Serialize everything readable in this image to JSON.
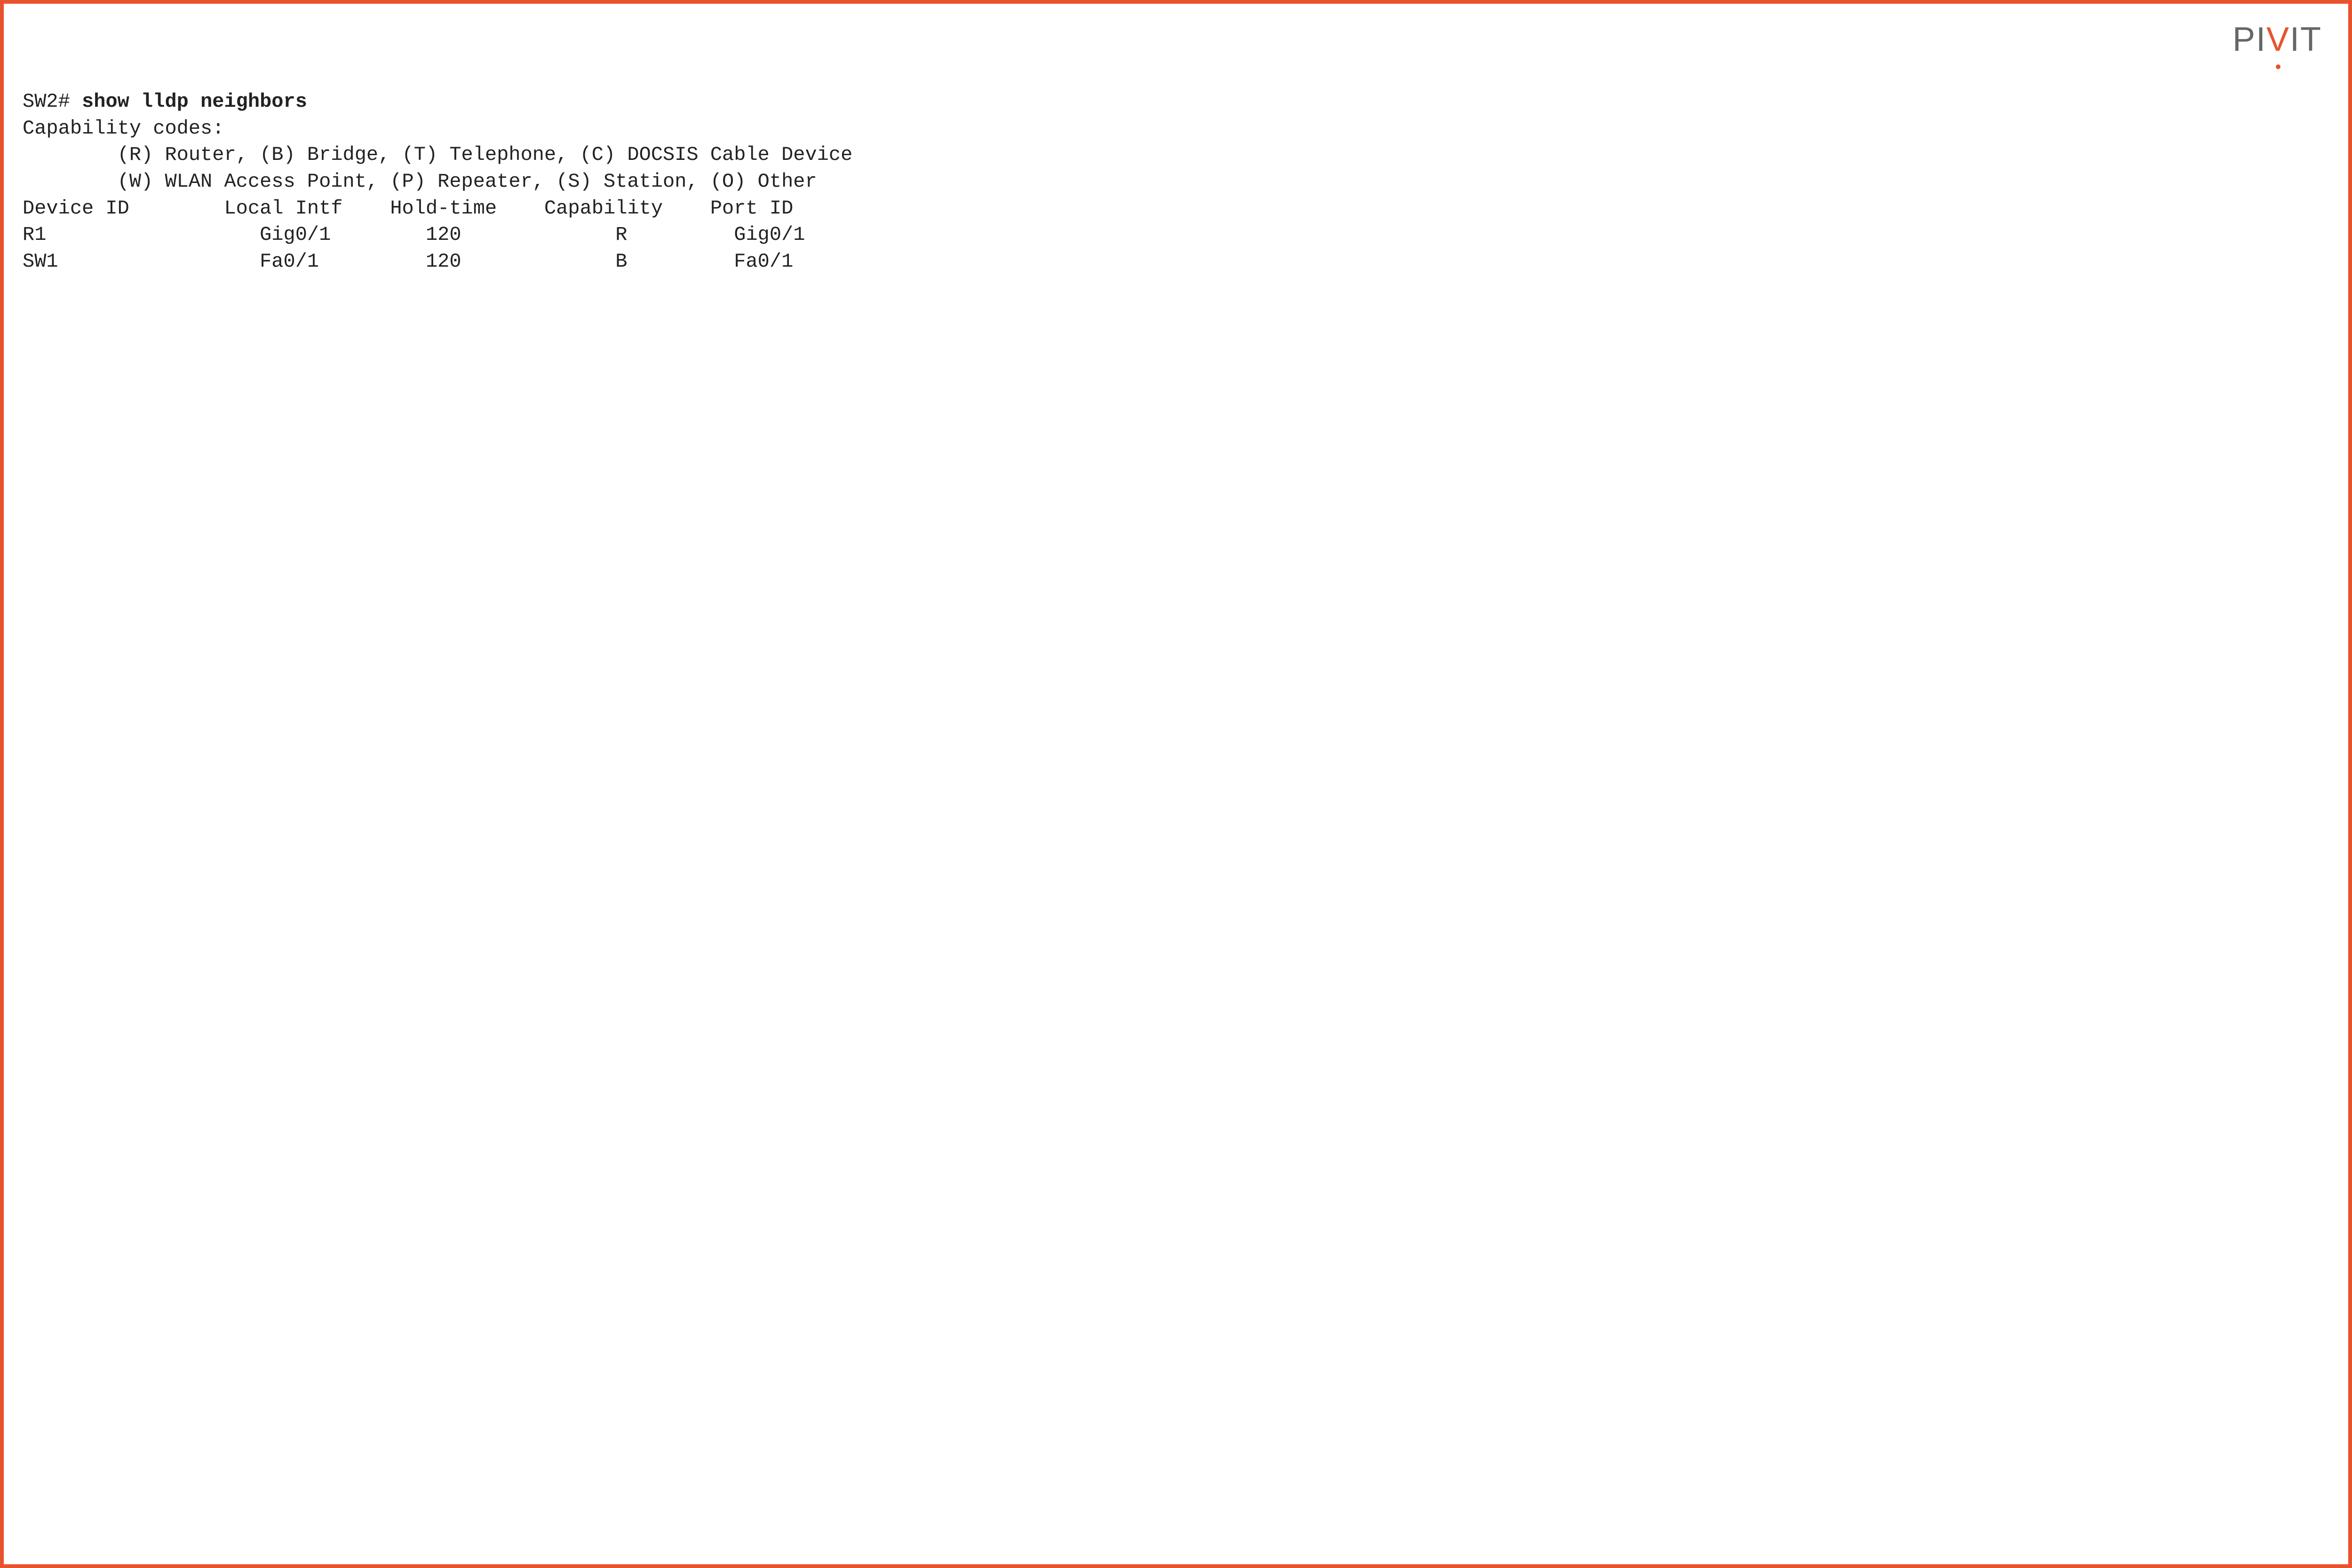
{
  "logo": {
    "p1": "PI",
    "v": "V",
    "p2": "IT"
  },
  "prompt": "SW2# ",
  "command": "show lldp neighbors",
  "cap_header": "Capability codes:",
  "cap_line1": "        (R) Router, (B) Bridge, (T) Telephone, (C) DOCSIS Cable Device",
  "cap_line2": "        (W) WLAN Access Point, (P) Repeater, (S) Station, (O) Other",
  "table_header": "Device ID        Local Intf    Hold-time    Capability    Port ID",
  "rows": [
    "R1                  Gig0/1        120             R         Gig0/1",
    "SW1                 Fa0/1         120             B         Fa0/1"
  ]
}
